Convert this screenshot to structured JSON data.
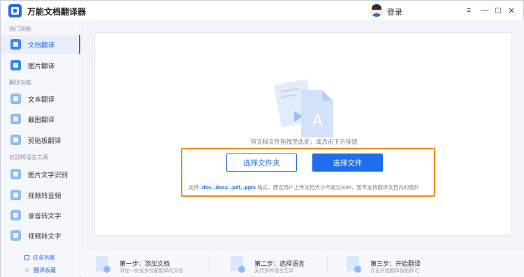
{
  "app": {
    "title": "万能文档翻译器",
    "login_label": "登录"
  },
  "window_controls": {
    "menu": "≡",
    "minimize": "—",
    "maximize": "☐",
    "close": "✕"
  },
  "sidebar": {
    "sections": [
      {
        "title": "热门功能"
      },
      {
        "title": "翻译功能"
      },
      {
        "title": "识别转语言工具"
      }
    ],
    "items": [
      {
        "label": "文档翻译",
        "icon": "document-translate-icon",
        "active": true
      },
      {
        "label": "图片翻译",
        "icon": "image-translate-icon",
        "active": false
      },
      {
        "label": "文本翻译",
        "icon": "text-translate-icon",
        "active": false
      },
      {
        "label": "截图翻译",
        "icon": "screenshot-translate-icon",
        "active": false
      },
      {
        "label": "剪贴板翻译",
        "icon": "clipboard-translate-icon",
        "active": false
      },
      {
        "label": "图片文字识别",
        "icon": "ocr-icon",
        "active": false
      },
      {
        "label": "视频转音频",
        "icon": "video-to-audio-icon",
        "active": false
      },
      {
        "label": "录音转文字",
        "icon": "audio-to-text-icon",
        "active": false
      },
      {
        "label": "视频转文字",
        "icon": "video-to-text-icon",
        "active": false
      }
    ],
    "bottom_links": [
      {
        "label": "任务列表",
        "icon": "task-list-icon"
      },
      {
        "label": "翻译收藏",
        "icon": "star-icon"
      }
    ]
  },
  "main": {
    "drop_hint": "将文档文件拖拽至此处，或点击下方按钮",
    "select_folder_label": "选择文件夹",
    "select_file_label": "选择文件",
    "support_prefix": "支持",
    "support_formats": ".doc, .docx, .pdf, .pptx",
    "support_suffix": "格式，建议用户上传文档大小不超过50M，暂不支持翻译文档内的图片"
  },
  "steps": [
    {
      "title": "第一步：添加文档",
      "desc": "添加一份或多份要翻译的文档"
    },
    {
      "title": "第二步：选择语言",
      "desc": "支持多种语言互译"
    },
    {
      "title": "第三步：开始翻译",
      "desc": "点击开始翻译按钮即可"
    }
  ],
  "colors": {
    "accent": "#1f6dea",
    "highlight": "#f08a1c"
  }
}
